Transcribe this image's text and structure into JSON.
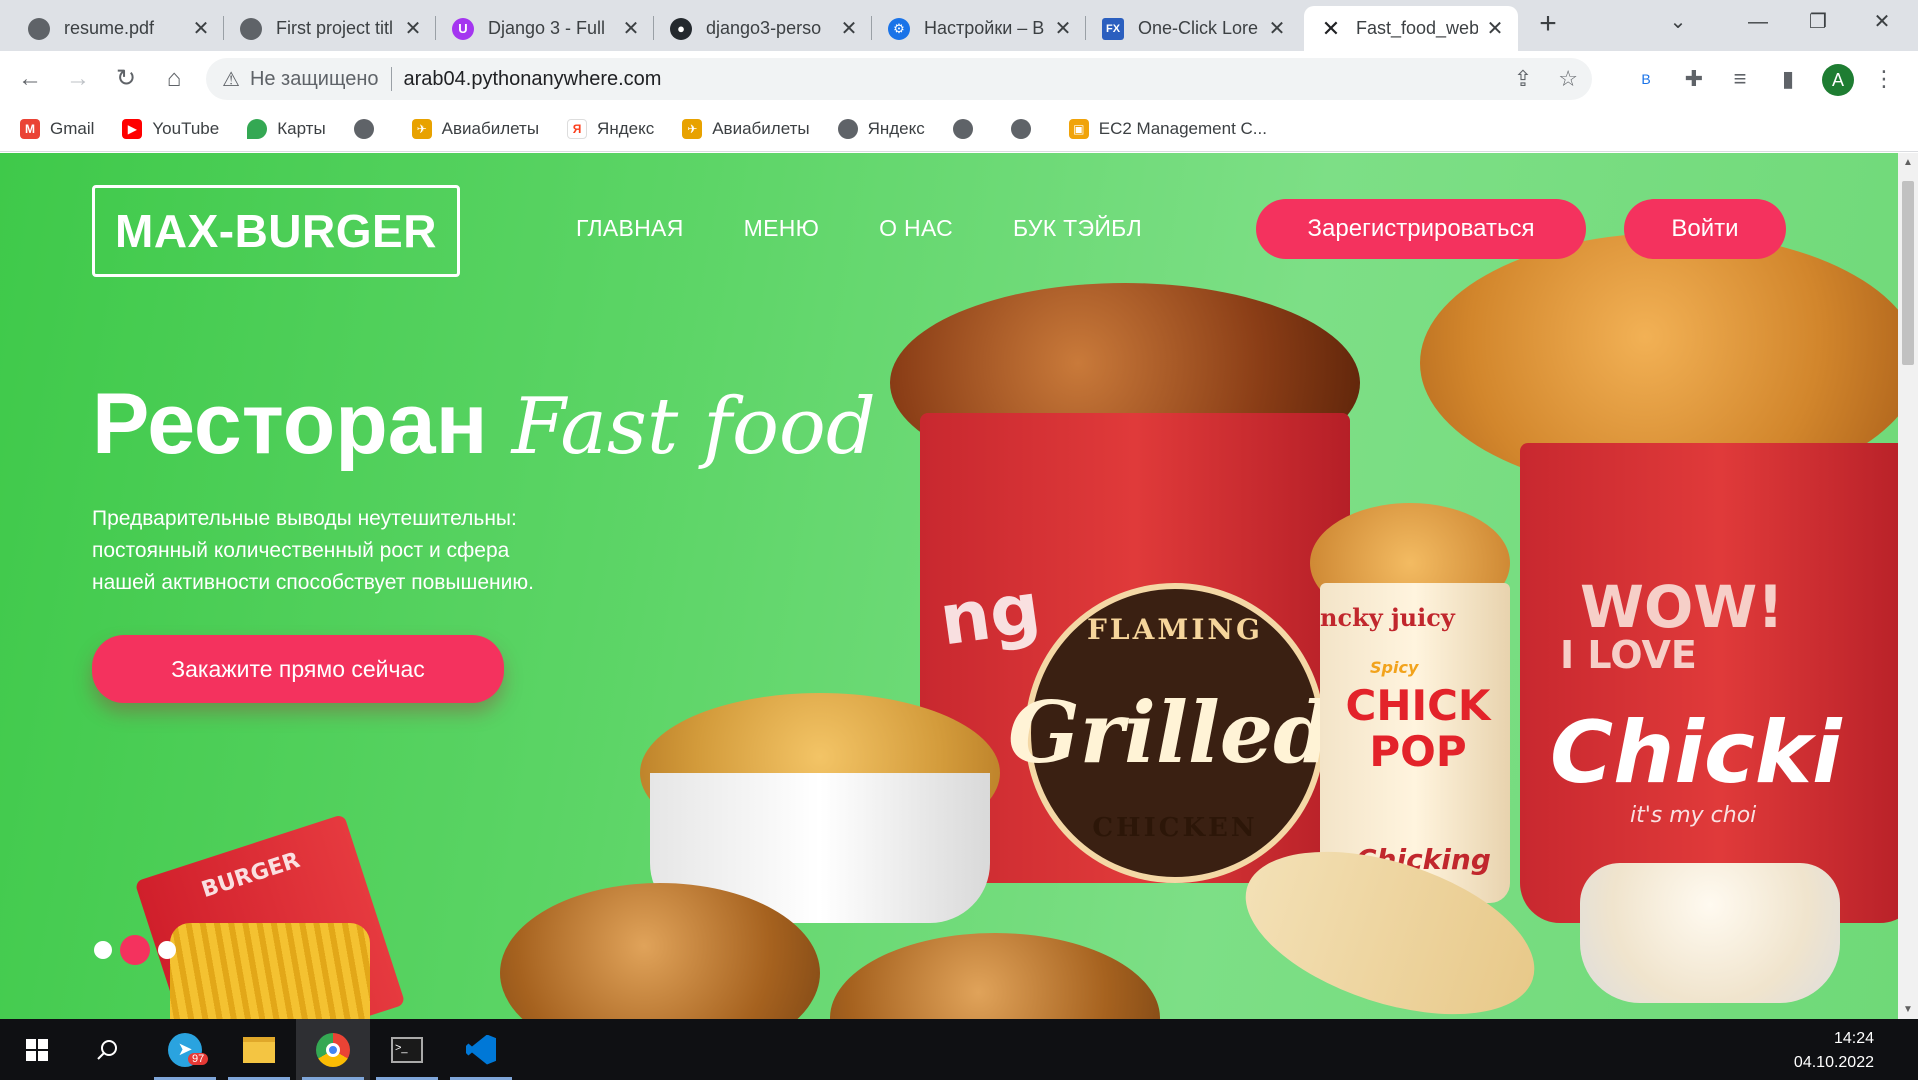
{
  "browser": {
    "tabs": [
      {
        "title": "resume.pdf",
        "icon": "globe-icon"
      },
      {
        "title": "First project titl",
        "icon": "globe-icon"
      },
      {
        "title": "Django 3 - Full",
        "icon": "udemy-icon"
      },
      {
        "title": "django3-perso",
        "icon": "github-icon"
      },
      {
        "title": "Настройки – В",
        "icon": "settings-icon"
      },
      {
        "title": "One-Click Lore",
        "icon": "fx-icon"
      },
      {
        "title": "Fast_food_web",
        "icon": "fork-knife-icon"
      }
    ],
    "address": {
      "security_label": "Не защищено",
      "url": "arab04.pythonanywhere.com"
    },
    "profile_initial": "A",
    "translate_label": "B",
    "bookmarks": [
      {
        "label": "Gmail",
        "icon": "gmail-icon"
      },
      {
        "label": "YouTube",
        "icon": "youtube-icon"
      },
      {
        "label": "Карты",
        "icon": "maps-icon"
      },
      {
        "label": "",
        "icon": "globe-icon"
      },
      {
        "label": "Авиабилеты",
        "icon": "aviasales-icon"
      },
      {
        "label": "Яндекс",
        "icon": "yandex-icon"
      },
      {
        "label": "Авиабилеты",
        "icon": "aviasales-icon"
      },
      {
        "label": "Яндекс",
        "icon": "globe-icon"
      },
      {
        "label": "",
        "icon": "globe-icon"
      },
      {
        "label": "",
        "icon": "globe-icon"
      },
      {
        "label": "EC2 Management C...",
        "icon": "aws-icon"
      }
    ]
  },
  "site": {
    "logo": "MAX-BURGER",
    "nav": [
      "ГЛАВНАЯ",
      "МЕНЮ",
      "О НАС",
      "БУК ТЭЙБЛ"
    ],
    "register_label": "Зарегистрироваться",
    "login_label": "Войти",
    "hero": {
      "title": "Ресторан",
      "title_script": "Fast food",
      "text": "Предварительные выводы неутешительны: постоянный количественный рост и сфера нашей активности способствует повышению.",
      "cta": "Закажите прямо сейчас"
    },
    "carousel": {
      "slides": 3,
      "active_index": 1
    },
    "image_text": {
      "badge_top": "FLAMING",
      "badge_script": "Grilled",
      "badge_bottom": "CHICKEN",
      "cup_top": "ncky juicy",
      "cup_brand": "CHICK POP",
      "cup_small": "Spicy",
      "cup_bottom": "Chicking",
      "bucket2_wow": "WOW!",
      "bucket2_love": "I LOVE",
      "bucket2_brand": "Chicki",
      "bucket2_tag": "it's my choi",
      "bucket1_ng": "ng",
      "fries_box": "BURGER"
    },
    "colors": {
      "accent": "#f4325e",
      "hero_green": "#5dd567"
    }
  },
  "taskbar": {
    "apps": [
      "start-icon",
      "search-icon",
      "telegram-icon",
      "file-explorer-icon",
      "chrome-icon",
      "terminal-icon",
      "vscode-icon"
    ],
    "telegram_badge": "97",
    "time": "14:24",
    "date": "04.10.2022"
  }
}
